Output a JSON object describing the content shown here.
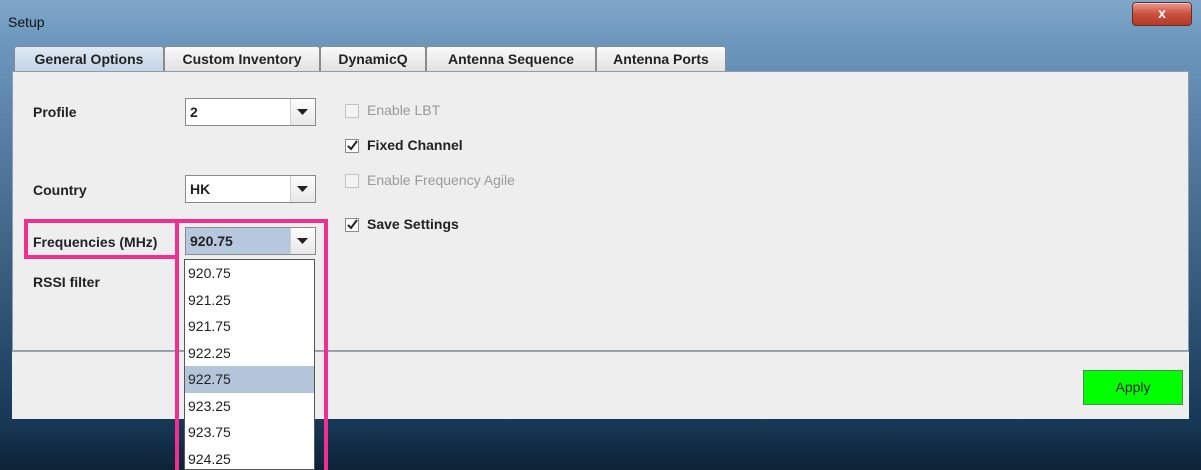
{
  "window": {
    "title": "Setup",
    "close_label": "x"
  },
  "tabs": [
    {
      "label": "General Options",
      "active": true
    },
    {
      "label": "Custom Inventory",
      "active": false
    },
    {
      "label": "DynamicQ",
      "active": false
    },
    {
      "label": "Antenna Sequence",
      "active": false
    },
    {
      "label": "Antenna Ports",
      "active": false
    }
  ],
  "fields": {
    "profile": {
      "label": "Profile",
      "value": "2"
    },
    "country": {
      "label": "Country",
      "value": "HK"
    },
    "frequencies": {
      "label": "Frequencies (MHz)",
      "value": "920.75"
    },
    "rssi": {
      "label": "RSSI filter"
    }
  },
  "checkboxes": {
    "enable_lbt": {
      "label": "Enable LBT",
      "checked": false,
      "enabled": false
    },
    "fixed_channel": {
      "label": "Fixed Channel",
      "checked": true,
      "enabled": true
    },
    "enable_freq_agile": {
      "label": "Enable Frequency Agile",
      "checked": false,
      "enabled": false
    },
    "save_settings": {
      "label": "Save Settings",
      "checked": true,
      "enabled": true
    }
  },
  "dropdown": {
    "options": [
      "920.75",
      "921.25",
      "921.75",
      "922.25",
      "922.75",
      "923.25",
      "923.75",
      "924.25"
    ],
    "highlighted": "922.75"
  },
  "footer": {
    "apply_label": "Apply"
  },
  "colors": {
    "apply": "#00ff00",
    "annotation": "#f0308e",
    "highlight_row": "#b4c5d9"
  }
}
